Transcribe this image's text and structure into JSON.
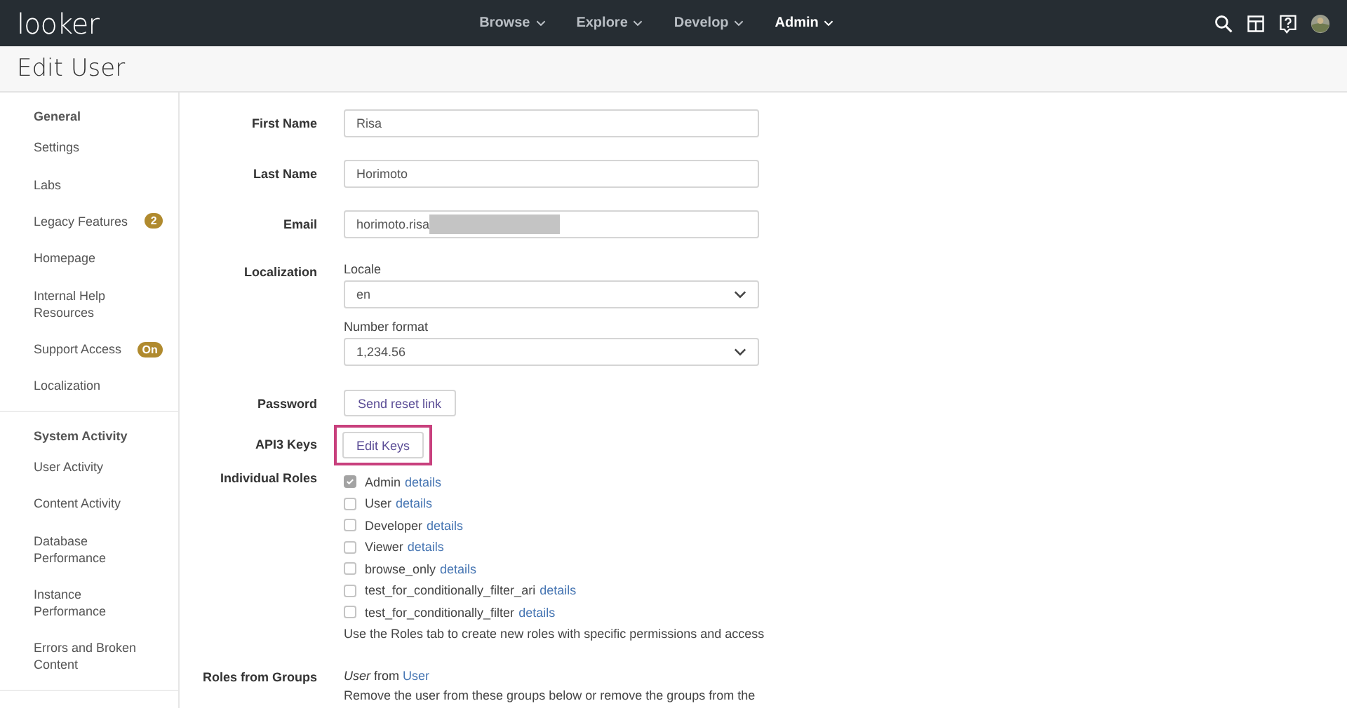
{
  "header": {
    "logo": "looker",
    "nav": [
      {
        "label": "Browse",
        "selected": false
      },
      {
        "label": "Explore",
        "selected": false
      },
      {
        "label": "Develop",
        "selected": false
      },
      {
        "label": "Admin",
        "selected": true
      }
    ]
  },
  "page_title": "Edit User",
  "sidebar": {
    "sections": [
      {
        "title": "General",
        "items": [
          {
            "label": "Settings"
          },
          {
            "label": "Labs"
          },
          {
            "label": "Legacy Features",
            "badge": "2"
          },
          {
            "label": "Homepage"
          },
          {
            "label": "Internal Help Resources"
          },
          {
            "label": "Support Access",
            "badge": "On"
          },
          {
            "label": "Localization"
          }
        ]
      },
      {
        "title": "System Activity",
        "items": [
          {
            "label": "User Activity"
          },
          {
            "label": "Content Activity"
          },
          {
            "label": "Database Performance"
          },
          {
            "label": "Instance Performance"
          },
          {
            "label": "Errors and Broken Content"
          }
        ]
      }
    ]
  },
  "form": {
    "rows": [
      {
        "kind": "text",
        "label": "First Name",
        "value": "Risa"
      },
      {
        "kind": "text",
        "label": "Last Name",
        "value": "Horimoto"
      },
      {
        "kind": "text",
        "label": "Email",
        "value": "horimoto.risa",
        "redacted": true
      },
      {
        "kind": "selects",
        "label": "Localization",
        "selects": [
          {
            "caption": "Locale",
            "value": "en"
          },
          {
            "caption": "Number format",
            "value": "1,234.56"
          }
        ]
      },
      {
        "kind": "button",
        "label": "Password",
        "button": "Send reset link",
        "highlighted": false
      },
      {
        "kind": "button",
        "label": "API3 Keys",
        "button": "Edit Keys",
        "highlighted": true
      },
      {
        "kind": "roles",
        "label": "Individual Roles",
        "roles": [
          {
            "name": "Admin",
            "link": "details",
            "checked": true
          },
          {
            "name": "User",
            "link": "details",
            "checked": false
          },
          {
            "name": "Developer",
            "link": "details",
            "checked": false
          },
          {
            "name": "Viewer",
            "link": "details",
            "checked": false
          },
          {
            "name": "browse_only",
            "link": "details",
            "checked": false
          },
          {
            "name": "test_for_conditionally_filter_ari",
            "link": "details",
            "checked": false
          },
          {
            "name": "test_for_conditionally_filter",
            "link": "details",
            "checked": false
          }
        ],
        "note": "Use the Roles tab to create new roles with specific permissions and access"
      },
      {
        "kind": "groups",
        "label": "Roles from Groups",
        "source": "*User* from",
        "group": "User",
        "note": "Remove the user from these groups below or remove the groups from the"
      }
    ]
  }
}
